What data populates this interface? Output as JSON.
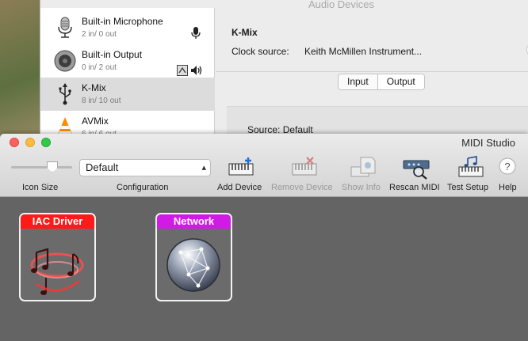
{
  "audio": {
    "title": "Audio Devices",
    "devices": [
      {
        "name": "Built-in Microphone",
        "sub": "2 in/ 0 out"
      },
      {
        "name": "Built-in Output",
        "sub": "0 in/ 2 out"
      },
      {
        "name": "K-Mix",
        "sub": "8 in/ 10 out"
      },
      {
        "name": "AVMix",
        "sub": "6 in/ 6 out"
      }
    ],
    "detail": {
      "name": "K-Mix",
      "clock_label": "Clock source:",
      "clock_value": "Keith McMillen Instrument...",
      "tabs": [
        "Input",
        "Output"
      ],
      "source_label": "Source:  Default"
    }
  },
  "midi": {
    "title": "MIDI Studio",
    "config_value": "Default",
    "toolbar": {
      "icon_size": "Icon Size",
      "configuration": "Configuration",
      "add_device": "Add Device",
      "remove_device": "Remove Device",
      "show_info": "Show Info",
      "rescan_midi": "Rescan MIDI",
      "test_setup": "Test Setup",
      "help": "Help"
    },
    "devices": [
      {
        "name": "IAC Driver",
        "color": "#ff1a1a"
      },
      {
        "name": "Network",
        "color": "#d21ae6"
      }
    ]
  }
}
